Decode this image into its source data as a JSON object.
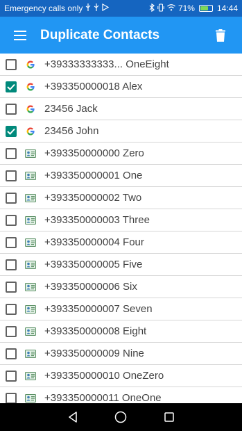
{
  "status_bar": {
    "carrier_text": "Emergency calls only",
    "battery_percent": "71%",
    "battery_level": 0.71,
    "time": "14:44",
    "icons": [
      "usb-icon",
      "usb-icon",
      "media-icon",
      "bluetooth-icon",
      "wifi-icon",
      "vibrate-icon",
      "battery-icon"
    ]
  },
  "app_bar": {
    "title": "Duplicate Contacts",
    "menu_icon": "hamburger-menu-icon",
    "action_icon": "trash-icon"
  },
  "colors": {
    "status_bar": "#1565c0",
    "app_bar": "#2196f3",
    "checkbox_checked": "#00897b",
    "nav_bar": "#000000"
  },
  "contacts": [
    {
      "label": "+39333333333... OneEight",
      "checked": false,
      "source": "google-icon"
    },
    {
      "label": "+393350000018 Alex",
      "checked": true,
      "source": "google-icon"
    },
    {
      "label": "23456 Jack",
      "checked": false,
      "source": "google-icon"
    },
    {
      "label": "23456 John",
      "checked": true,
      "source": "google-icon"
    },
    {
      "label": "+393350000000 Zero",
      "checked": false,
      "source": "sim-contact-icon"
    },
    {
      "label": "+393350000001 One",
      "checked": false,
      "source": "sim-contact-icon"
    },
    {
      "label": "+393350000002 Two",
      "checked": false,
      "source": "sim-contact-icon"
    },
    {
      "label": "+393350000003 Three",
      "checked": false,
      "source": "sim-contact-icon"
    },
    {
      "label": "+393350000004 Four",
      "checked": false,
      "source": "sim-contact-icon"
    },
    {
      "label": "+393350000005 Five",
      "checked": false,
      "source": "sim-contact-icon"
    },
    {
      "label": "+393350000006 Six",
      "checked": false,
      "source": "sim-contact-icon"
    },
    {
      "label": "+393350000007 Seven",
      "checked": false,
      "source": "sim-contact-icon"
    },
    {
      "label": "+393350000008 Eight",
      "checked": false,
      "source": "sim-contact-icon"
    },
    {
      "label": "+393350000009 Nine",
      "checked": false,
      "source": "sim-contact-icon"
    },
    {
      "label": "+393350000010 OneZero",
      "checked": false,
      "source": "sim-contact-icon"
    },
    {
      "label": "+393350000011 OneOne",
      "checked": false,
      "source": "sim-contact-icon"
    }
  ],
  "nav_bar": {
    "buttons": [
      "back-icon",
      "home-icon",
      "recents-icon"
    ]
  }
}
